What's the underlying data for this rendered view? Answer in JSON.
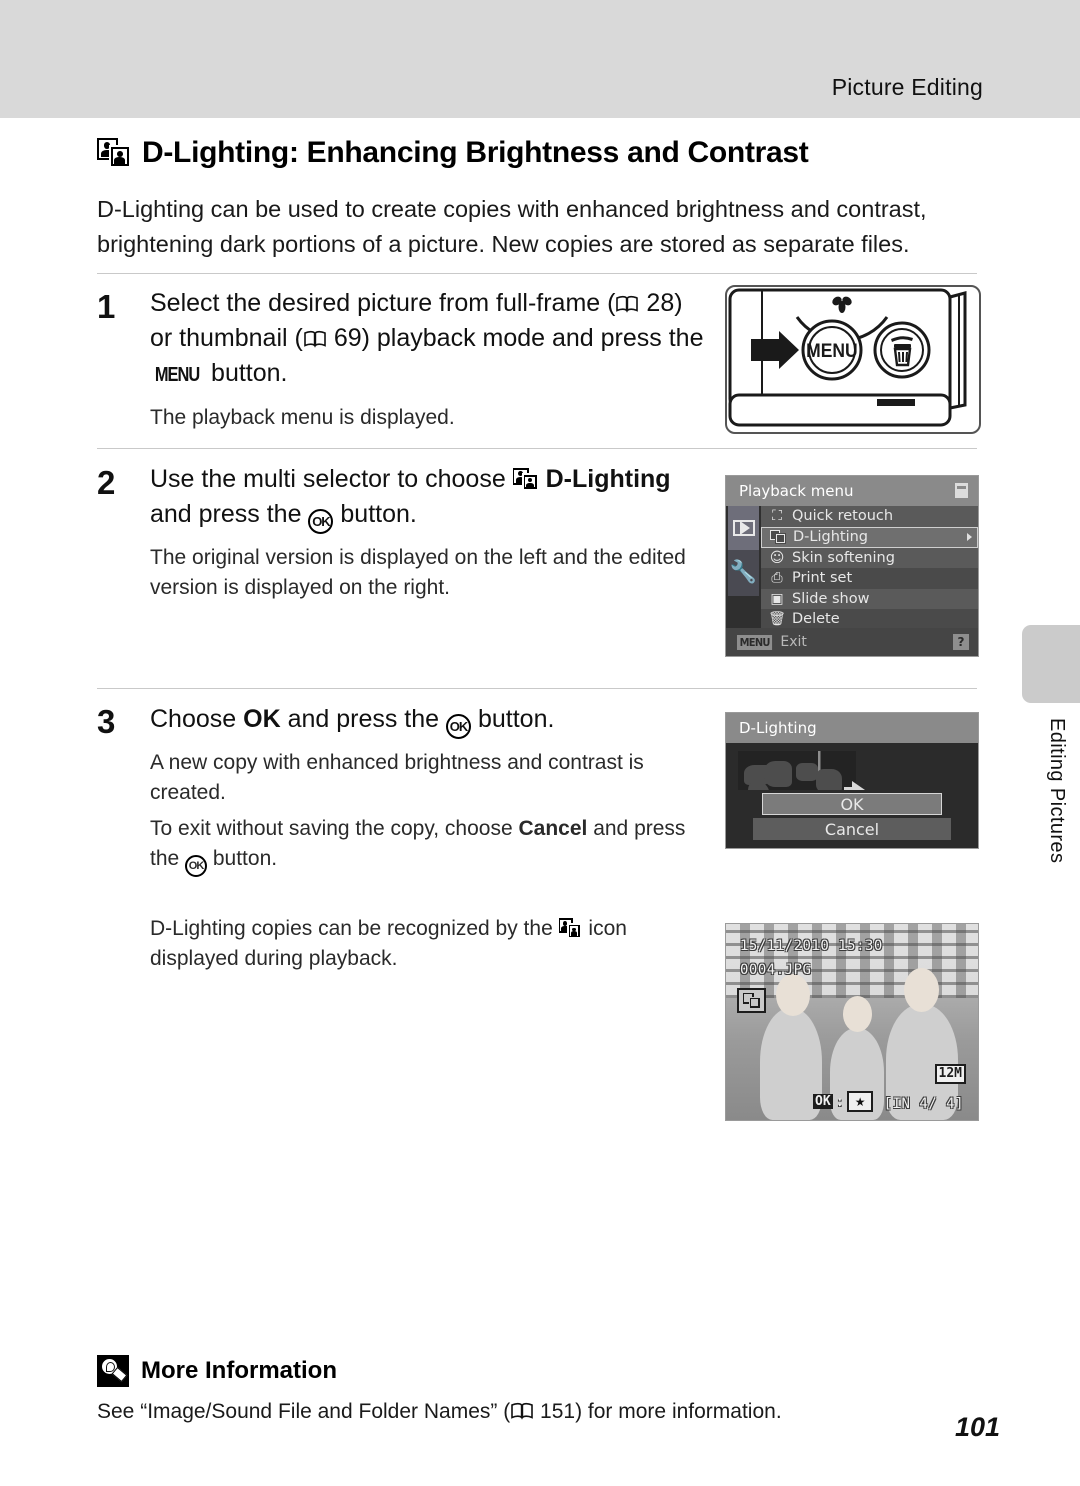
{
  "header": {
    "running_head": "Picture Editing"
  },
  "section": {
    "icon": "d-lighting-icon",
    "title": "D-Lighting: Enhancing Brightness and Contrast",
    "intro": "D-Lighting can be used to create copies with enhanced brightness and contrast, brightening dark portions of a picture. New copies are stored as separate files."
  },
  "steps": [
    {
      "number": "1",
      "title_part1": "Select the desired picture from full-frame (",
      "ref1": "28",
      "title_part2": ") or thumbnail (",
      "ref2": "69",
      "title_part3": ") playback mode and press the ",
      "menu_glyph": "MENU",
      "title_part4": " button.",
      "body": "The playback menu is displayed."
    },
    {
      "number": "2",
      "title_part1": "Use the multi selector to choose ",
      "bold_term": "D-Lighting",
      "title_part2": " and press the ",
      "ok_glyph": "OK",
      "title_part3": " button.",
      "body": "The original version is displayed on the left and the edited version is displayed on the right."
    },
    {
      "number": "3",
      "title_part1": "Choose ",
      "bold_term": "OK",
      "title_part2": " and press the ",
      "ok_glyph": "OK",
      "title_part3": " button.",
      "body1": "A new copy with enhanced brightness and contrast is created.",
      "body2_part1": "To exit without saving the copy, choose ",
      "body2_bold": "Cancel",
      "body2_part2": " and press the ",
      "body2_part3": " button."
    }
  ],
  "note": {
    "part1": "D-Lighting copies can be recognized by the ",
    "part2": " icon displayed during playback."
  },
  "camera_figure": {
    "menu_button_label": "MENU",
    "delete_button_label": "trash-icon",
    "macro_label": "macro-flower-icon"
  },
  "playback_menu": {
    "title": "Playback menu",
    "items": [
      {
        "icon": "quick-retouch-icon",
        "label": "Quick retouch",
        "selected": false
      },
      {
        "icon": "d-lighting-icon",
        "label": "D-Lighting",
        "selected": true
      },
      {
        "icon": "skin-softening-icon",
        "label": "Skin softening",
        "selected": false
      },
      {
        "icon": "print-set-icon",
        "label": "Print set",
        "selected": false
      },
      {
        "icon": "slide-show-icon",
        "label": "Slide show",
        "selected": false
      },
      {
        "icon": "delete-icon",
        "label": "Delete",
        "selected": false
      }
    ],
    "footer_button": "MENU",
    "footer_label": "Exit",
    "help_label": "?"
  },
  "dlighting_screen": {
    "title": "D-Lighting",
    "ok_label": "OK",
    "cancel_label": "Cancel"
  },
  "photo_screen": {
    "datetime": "15/11/2010 15:30",
    "filename": "0004.JPG",
    "dlighting_badge": "d-lighting-icon",
    "image_size": "12M",
    "ok_label": "OK",
    "colon": ":",
    "star": "★",
    "frame_counter": "[IN    4/    4]"
  },
  "side_tab": {
    "label": "Editing Pictures"
  },
  "more_information": {
    "icon": "lightbulb-icon",
    "title": "More Information",
    "text_part1": "See “Image/Sound File and Folder Names” (",
    "ref": "151",
    "text_part2": ") for more information."
  },
  "page_number": "101"
}
